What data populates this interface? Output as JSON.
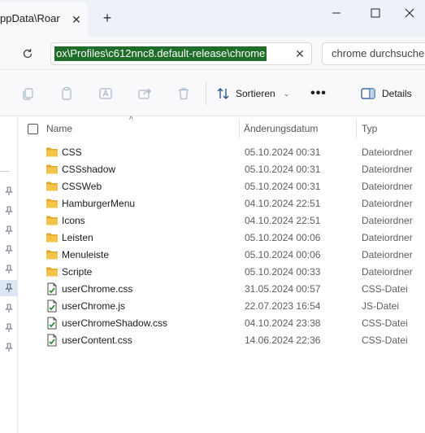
{
  "window": {
    "tab_title": "ppData\\Roar",
    "tab_close": "✕",
    "new_tab": "+"
  },
  "address": {
    "path": "ox\\Profiles\\c612nnc8.default-release\\chrome",
    "clear": "✕",
    "search_placeholder": "chrome durchsuchen"
  },
  "toolbar": {
    "sort_label": "Sortieren",
    "more_label": "•••",
    "details_label": "Details"
  },
  "columns": {
    "name": "Name",
    "date": "Änderungsdatum",
    "type": "Typ"
  },
  "files": [
    {
      "name": "CSS",
      "date": "05.10.2024 00:31",
      "type": "Dateiordner",
      "icon": "folder-icon"
    },
    {
      "name": "CSSshadow",
      "date": "05.10.2024 00:31",
      "type": "Dateiordner",
      "icon": "folder-icon"
    },
    {
      "name": "CSSWeb",
      "date": "05.10.2024 00:31",
      "type": "Dateiordner",
      "icon": "folder-icon"
    },
    {
      "name": "HamburgerMenu",
      "date": "04.10.2024 22:51",
      "type": "Dateiordner",
      "icon": "folder-icon"
    },
    {
      "name": "Icons",
      "date": "04.10.2024 22:51",
      "type": "Dateiordner",
      "icon": "folder-icon"
    },
    {
      "name": "Leisten",
      "date": "05.10.2024 00:06",
      "type": "Dateiordner",
      "icon": "folder-icon"
    },
    {
      "name": "Menuleiste",
      "date": "05.10.2024 00:06",
      "type": "Dateiordner",
      "icon": "folder-icon"
    },
    {
      "name": "Scripte",
      "date": "05.10.2024 00:33",
      "type": "Dateiordner",
      "icon": "folder-icon"
    },
    {
      "name": "userChrome.css",
      "date": "31.05.2024 00:57",
      "type": "CSS-Datei",
      "icon": "css-file-icon"
    },
    {
      "name": "userChrome.js",
      "date": "22.07.2023 16:54",
      "type": "JS-Datei",
      "icon": "js-file-icon"
    },
    {
      "name": "userChromeShadow.css",
      "date": "04.10.2024 23:38",
      "type": "CSS-Datei",
      "icon": "css-file-icon"
    },
    {
      "name": "userContent.css",
      "date": "14.06.2024 22:36",
      "type": "CSS-Datei",
      "icon": "css-file-icon"
    }
  ],
  "colors": {
    "folder": "#f4c44a",
    "folder_dark": "#e2a72a",
    "selection": "#1e6e2a",
    "accent": "#0067c0"
  }
}
